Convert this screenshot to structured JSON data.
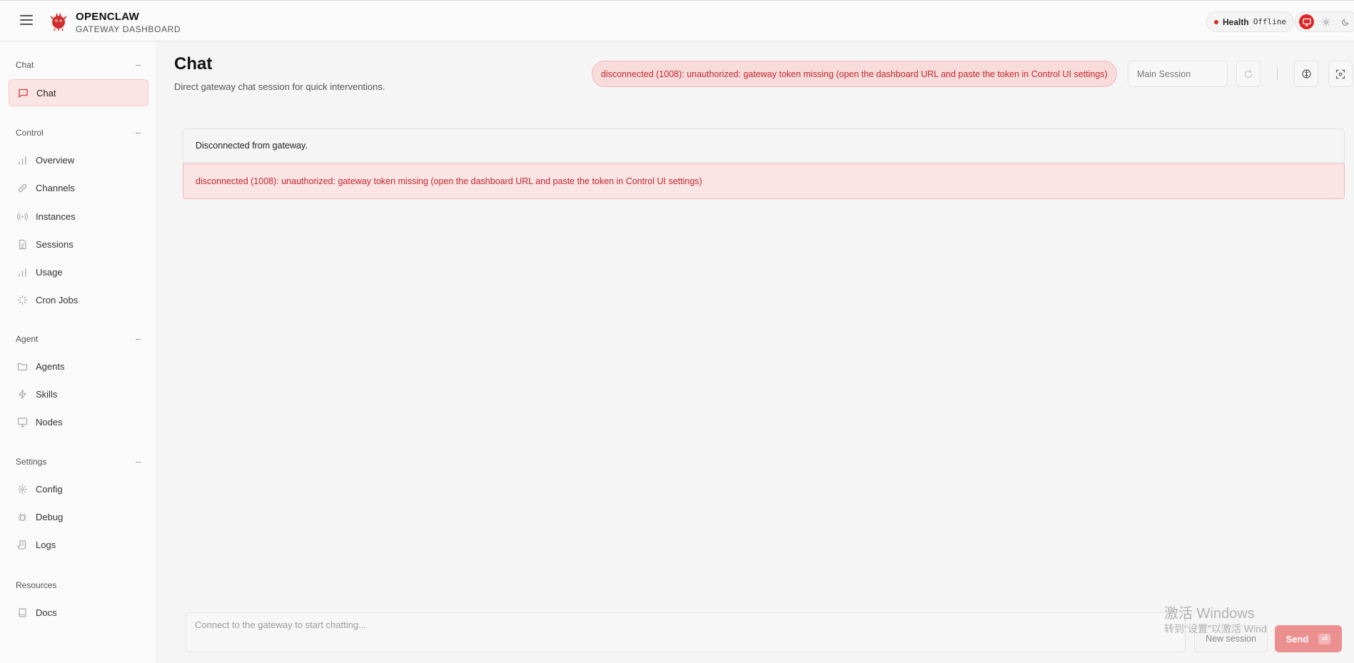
{
  "header": {
    "brand_name": "OPENCLAW",
    "brand_sub": "GATEWAY DASHBOARD",
    "health_label": "Health",
    "health_value": "Offline"
  },
  "sidebar": {
    "groups": [
      {
        "title": "Chat",
        "items": [
          {
            "label": "Chat",
            "icon": "message-square-icon",
            "active": true
          }
        ]
      },
      {
        "title": "Control",
        "items": [
          {
            "label": "Overview",
            "icon": "bar-chart-icon"
          },
          {
            "label": "Channels",
            "icon": "link-icon"
          },
          {
            "label": "Instances",
            "icon": "radio-icon"
          },
          {
            "label": "Sessions",
            "icon": "file-text-icon"
          },
          {
            "label": "Usage",
            "icon": "bar-chart-icon"
          },
          {
            "label": "Cron Jobs",
            "icon": "loader-icon"
          }
        ]
      },
      {
        "title": "Agent",
        "items": [
          {
            "label": "Agents",
            "icon": "folder-icon"
          },
          {
            "label": "Skills",
            "icon": "zap-icon"
          },
          {
            "label": "Nodes",
            "icon": "monitor-icon"
          }
        ]
      },
      {
        "title": "Settings",
        "items": [
          {
            "label": "Config",
            "icon": "gear-icon"
          },
          {
            "label": "Debug",
            "icon": "bug-icon"
          },
          {
            "label": "Logs",
            "icon": "scroll-icon"
          }
        ]
      },
      {
        "title": "Resources",
        "items": [
          {
            "label": "Docs",
            "icon": "book-icon"
          }
        ]
      }
    ]
  },
  "main": {
    "title": "Chat",
    "subtitle": "Direct gateway chat session for quick interventions.",
    "error_pill": "disconnected (1008): unauthorized: gateway token missing (open the dashboard URL and paste the token in Control UI settings)",
    "session_select": "Main Session",
    "messages": {
      "status": "Disconnected from gateway.",
      "error": "disconnected (1008): unauthorized: gateway token missing (open the dashboard URL and paste the token in Control UI settings)"
    },
    "composer_placeholder": "Connect to the gateway to start chatting...",
    "new_session_label": "New session",
    "send_label": "Send"
  },
  "watermark": {
    "line1": "激活 Windows",
    "line2": "转到\"设置\"以激活 Wind"
  },
  "colors": {
    "accent": "#dc2626",
    "error_text": "#c2272d",
    "active_nav_bg": "#fbe4e4",
    "send_bg": "#ec8f8f"
  }
}
